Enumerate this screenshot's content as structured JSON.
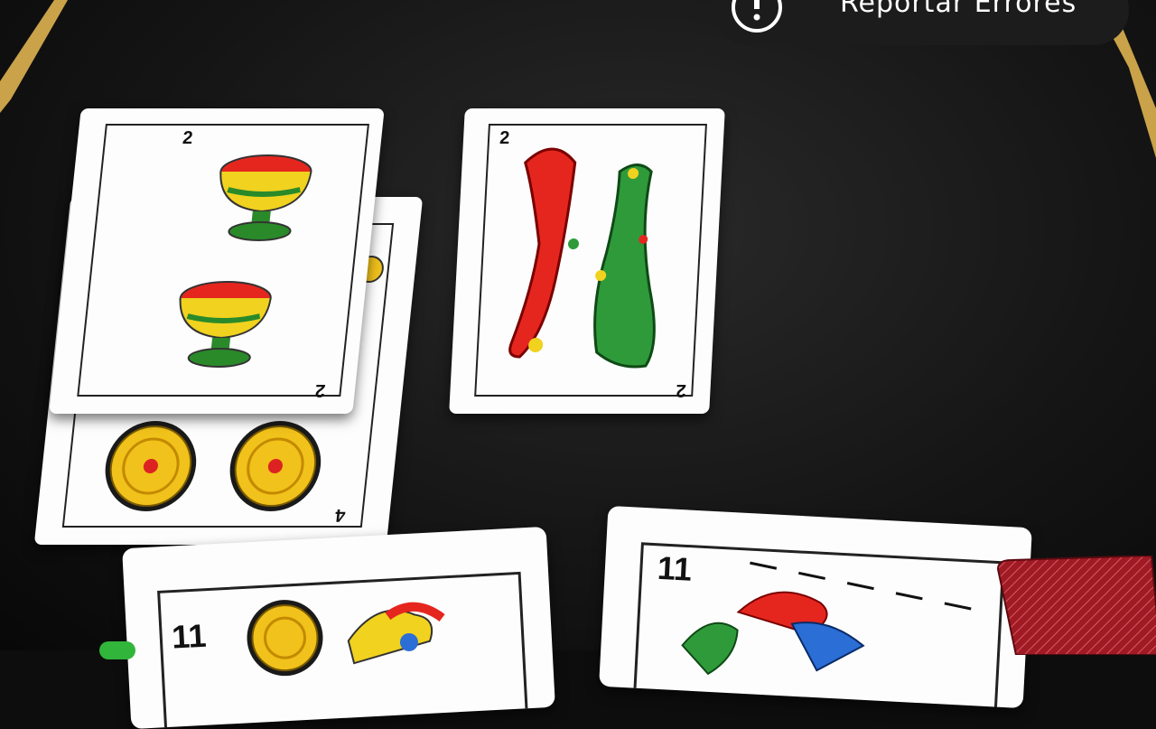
{
  "header": {
    "report_label": "Reportar Errores"
  },
  "table_cards": [
    {
      "rank": "2",
      "suit": "copas"
    },
    {
      "rank": "4",
      "suit": "oros"
    },
    {
      "rank": "2",
      "suit": "bastos"
    }
  ],
  "hand_cards": [
    {
      "rank": "11",
      "suit": "oros"
    },
    {
      "rank": "11",
      "suit": "bastos"
    }
  ],
  "colors": {
    "felt": "#151515",
    "rail": "#c9a24a",
    "card_back": "#a01a24"
  }
}
